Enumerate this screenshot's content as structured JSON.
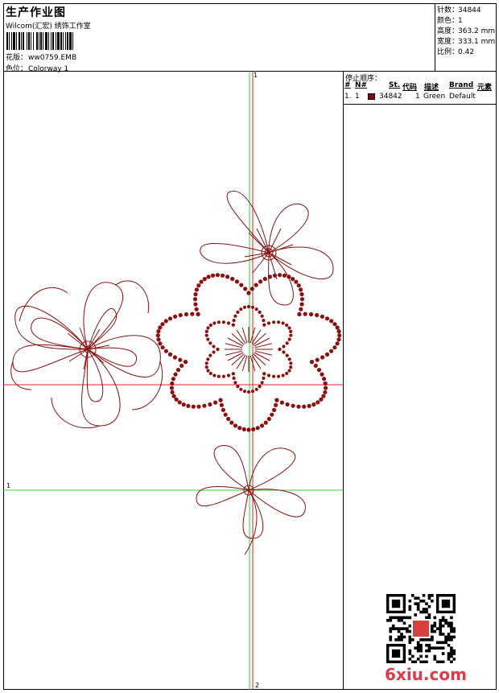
{
  "header": {
    "title": "生产作业图",
    "company": "Wilcom(汇宏) 绣饰工作室",
    "design_label": "花版：",
    "design_file": "ww0759.EMB",
    "colorway_label": "色位：",
    "colorway": "Colorway 1"
  },
  "stats": [
    {
      "label": "针数：",
      "value": "34844"
    },
    {
      "label": "颜色：",
      "value": "1"
    },
    {
      "label": "高度：",
      "value": "363.2 mm"
    },
    {
      "label": "宽度：",
      "value": "333.1 mm"
    },
    {
      "label": "比例：",
      "value": "0.42"
    }
  ],
  "stop_sequence": {
    "title": "停止顺序：",
    "columns": [
      "#",
      "N#",
      "St.",
      "代码",
      "描述",
      "Brand",
      "元素"
    ],
    "rows": [
      {
        "num": "1.",
        "n": "1",
        "stitches": "34842",
        "code": "1",
        "description": "Green",
        "brand": "Default",
        "color": "#7a0f0f"
      }
    ]
  },
  "guides": {
    "top": "1",
    "bottom": "2",
    "left": "1"
  },
  "embroidery_color": "#8b1010",
  "guide_color": "#2fd32f",
  "guide_red": "#e02020",
  "watermark": "6xiu.com"
}
